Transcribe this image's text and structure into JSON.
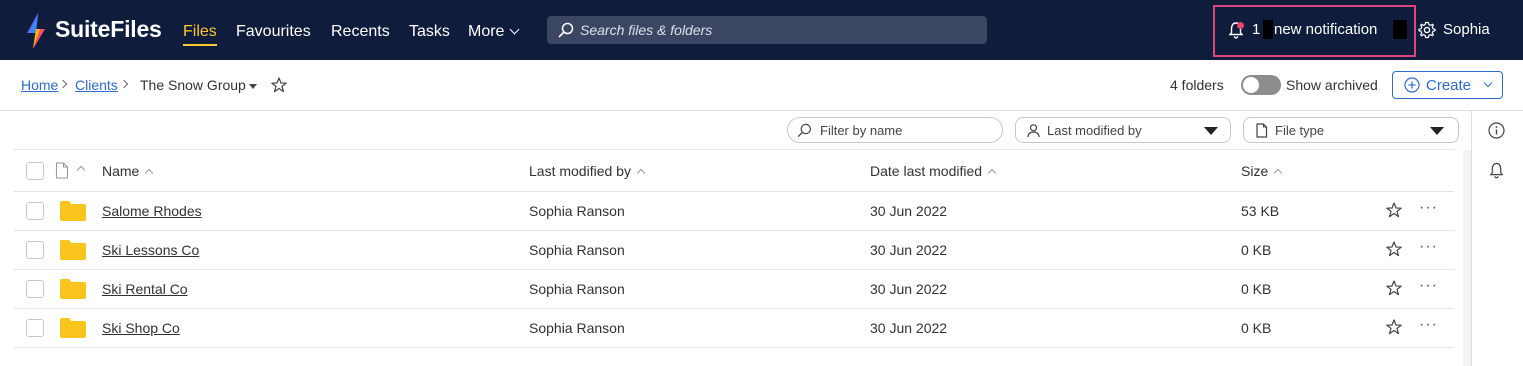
{
  "brand": {
    "name": "SuiteFiles"
  },
  "nav": {
    "items": [
      "Files",
      "Favourites",
      "Recents",
      "Tasks"
    ],
    "more_label": "More",
    "active": "Files"
  },
  "search": {
    "placeholder": "Search files & folders"
  },
  "notification": {
    "count": "1",
    "text": "new notification"
  },
  "user": {
    "name": "Sophia"
  },
  "breadcrumb": {
    "home": "Home",
    "clients": "Clients",
    "current": "The Snow Group"
  },
  "toolbar": {
    "folders_count": "4 folders",
    "show_archived": "Show archived",
    "create_label": "Create"
  },
  "filters": {
    "name_placeholder": "Filter by name",
    "modified_by": "Last modified by",
    "file_type": "File type"
  },
  "table": {
    "columns": [
      "Name",
      "Last modified by",
      "Date last modified",
      "Size"
    ],
    "rows": [
      {
        "name": "Salome Rhodes",
        "modified_by": "Sophia Ranson",
        "date": "30 Jun 2022",
        "size": "53 KB"
      },
      {
        "name": "Ski Lessons Co",
        "modified_by": "Sophia Ranson",
        "date": "30 Jun 2022",
        "size": "0 KB"
      },
      {
        "name": "Ski Rental Co",
        "modified_by": "Sophia Ranson",
        "date": "30 Jun 2022",
        "size": "0 KB"
      },
      {
        "name": "Ski Shop Co",
        "modified_by": "Sophia Ranson",
        "date": "30 Jun 2022",
        "size": "0 KB"
      }
    ],
    "more_glyph": "···"
  },
  "colors": {
    "nav_bg": "#0f1c3b",
    "active_nav": "#ffc72c",
    "accent": "#2d6bcf",
    "highlight_box": "#e0447c",
    "folder": "#f9c51c"
  },
  "icons": [
    "logo-icon",
    "search-icon",
    "bell-icon",
    "gear-icon",
    "star-icon",
    "plus-icon",
    "info-icon",
    "person-icon",
    "file-icon",
    "folder-icon",
    "more-icon"
  ]
}
